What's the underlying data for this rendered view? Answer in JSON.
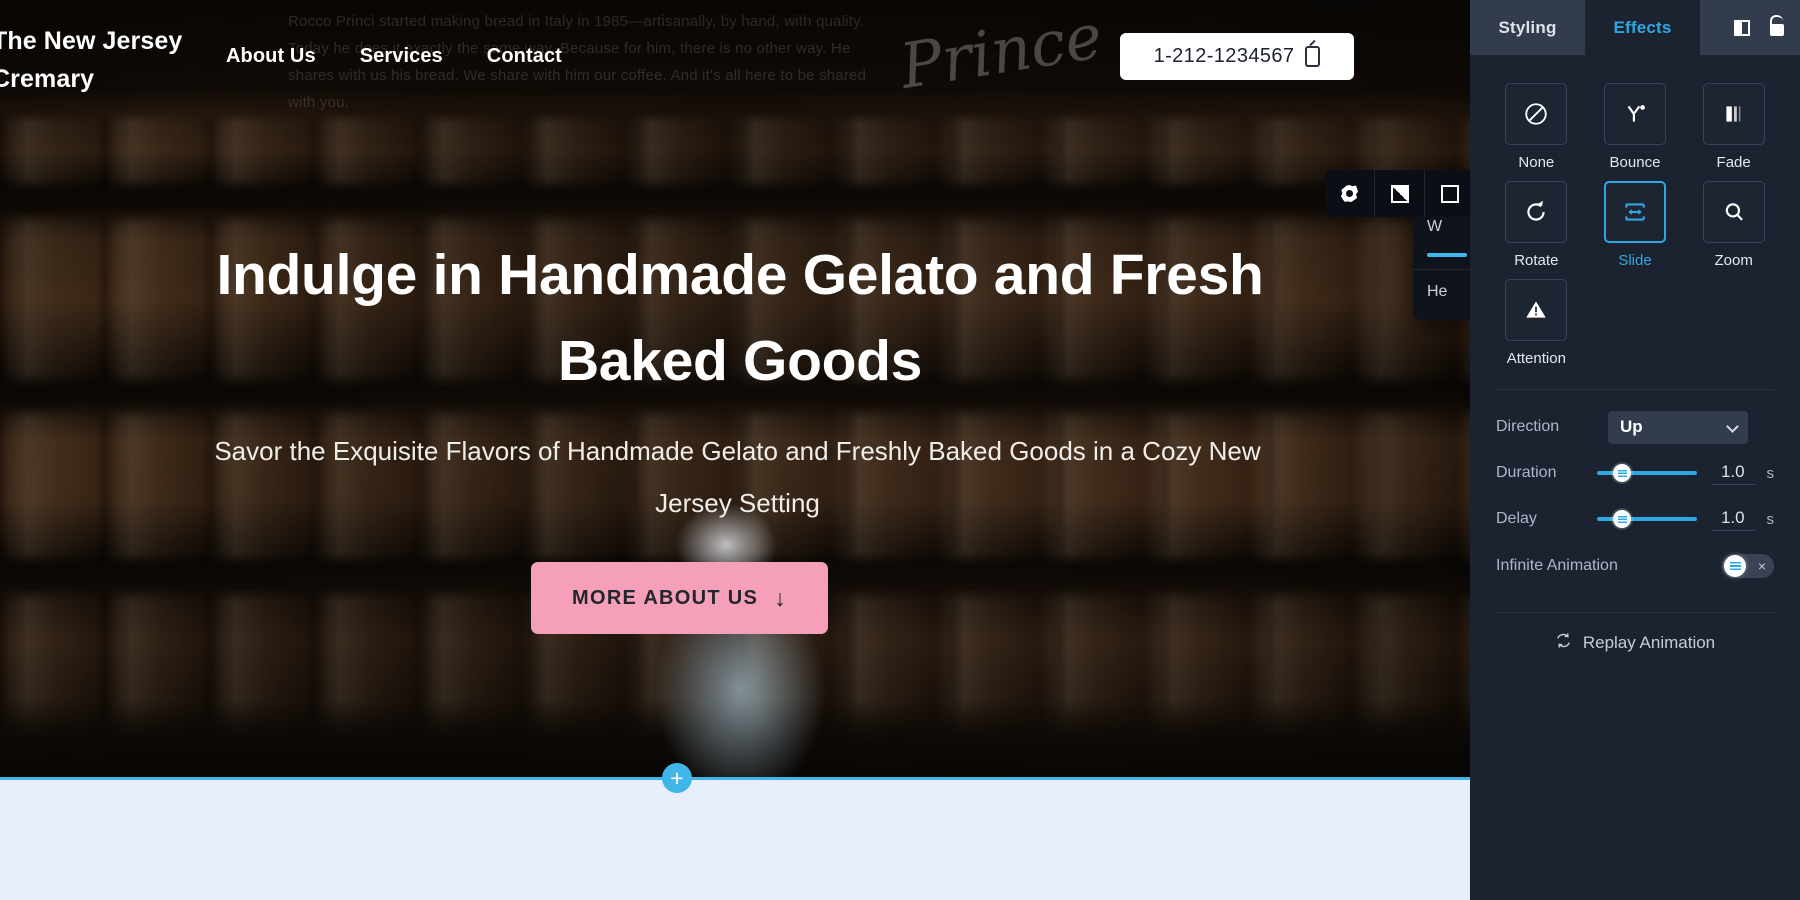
{
  "canvas": {
    "site": {
      "logo": "The New Jersey Cremary",
      "nav": [
        {
          "label": "About Us"
        },
        {
          "label": "Services"
        },
        {
          "label": "Contact"
        }
      ],
      "phone": "1-212-1234567",
      "signature": "Prince",
      "wall_text": "Rocco Princi started making bread in Italy in 1985—artisanally, by hand, with quality. Today he does it exactly the same way. Because for him, there is no other way. He shares with us his bread. We share with him our coffee. And it's all here to be shared with you.",
      "hero": {
        "heading": "Indulge in Handmade Gelato and Fresh Baked Goods",
        "subheading": "Savor the Exquisite Flavors of Handmade Gelato and Freshly Baked Goods in a Cozy New Jersey Setting",
        "cta_label": "MORE ABOUT US",
        "cta_arrow": "↓"
      }
    },
    "element_toolbar": [
      {
        "icon": "settings-icon"
      },
      {
        "icon": "contrast-icon"
      },
      {
        "icon": "square-icon"
      }
    ],
    "hidden_panel": {
      "row1": "W",
      "row2": "He"
    },
    "add_section_label": "+"
  },
  "sidebar": {
    "tabs": [
      {
        "label": "Styling",
        "active": false
      },
      {
        "label": "Effects",
        "active": true
      }
    ],
    "tab_icons": [
      {
        "icon": "panel-toggle-icon"
      },
      {
        "icon": "unlock-icon"
      }
    ],
    "animations": [
      {
        "label": "None",
        "icon": "none-icon",
        "selected": false
      },
      {
        "label": "Bounce",
        "icon": "bounce-icon",
        "selected": false
      },
      {
        "label": "Fade",
        "icon": "fade-icon",
        "selected": false
      },
      {
        "label": "Rotate",
        "icon": "rotate-icon",
        "selected": false
      },
      {
        "label": "Slide",
        "icon": "slide-icon",
        "selected": true
      },
      {
        "label": "Zoom",
        "icon": "zoom-icon",
        "selected": false
      },
      {
        "label": "Attention",
        "icon": "attention-icon",
        "selected": false
      }
    ],
    "controls": {
      "direction_label": "Direction",
      "direction_value": "Up",
      "duration_label": "Duration",
      "duration_value": "1.0",
      "duration_unit": "s",
      "delay_label": "Delay",
      "delay_value": "1.0",
      "delay_unit": "s",
      "infinite_label": "Infinite Animation",
      "infinite_state": "off",
      "infinite_off_mark": "×",
      "replay_label": "Replay Animation"
    }
  },
  "colors": {
    "accent": "#2fa8e0",
    "sidebar_bg": "#1b2230",
    "tab_bg": "#333c4d",
    "cta_pink": "#f5a0b8",
    "section_band": "#e7eefc"
  }
}
